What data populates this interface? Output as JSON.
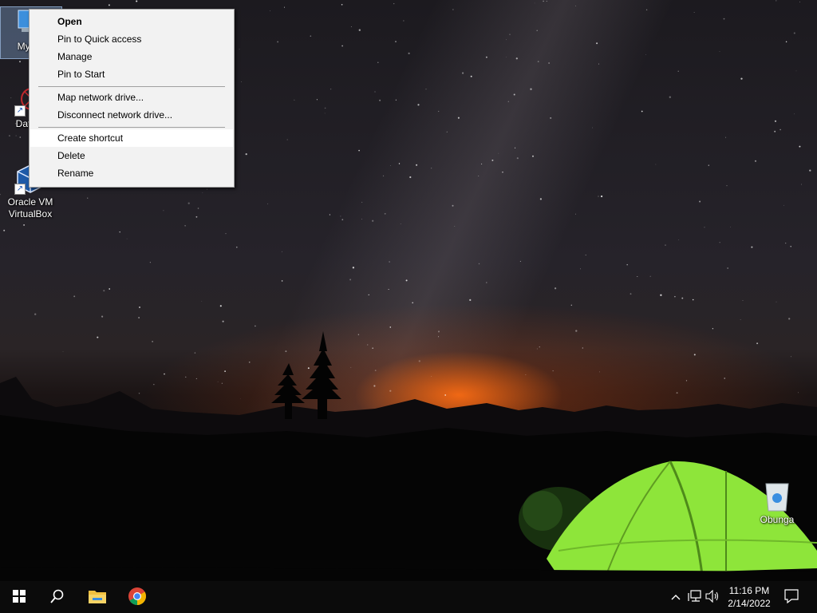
{
  "desktop": {
    "icons": [
      {
        "label": "My Co",
        "icon": "computer-icon"
      },
      {
        "label": "DataW",
        "icon": "datawrapper-icon"
      },
      {
        "label": "Oracle VM VirtualBox",
        "icon": "virtualbox-icon"
      },
      {
        "label": "Obunga",
        "icon": "recycle-bin-icon"
      }
    ]
  },
  "context_menu": {
    "items": [
      {
        "label": "Open",
        "bold": true
      },
      {
        "label": "Pin to Quick access"
      },
      {
        "label": "Manage"
      },
      {
        "label": "Pin to Start"
      },
      {
        "label": "Map network drive..."
      },
      {
        "label": "Disconnect network drive..."
      },
      {
        "label": "Create shortcut",
        "highlighted": true
      },
      {
        "label": "Delete"
      },
      {
        "label": "Rename"
      }
    ]
  },
  "taskbar": {
    "pinned": [
      "start-icon",
      "search-icon",
      "file-explorer-icon",
      "chrome-icon"
    ],
    "tray": [
      "chevron-up-icon",
      "network-icon",
      "volume-icon"
    ],
    "time": "11:16 PM",
    "date": "2/14/2022",
    "notification_icon": "action-center-icon"
  },
  "colors": {
    "menu_bg": "#f2f2f2",
    "menu_hover": "#ffffff",
    "taskbar_bg": "#0b0b0b",
    "tent_green": "#8ee53a",
    "horizon_glow": "#ff6a14"
  }
}
